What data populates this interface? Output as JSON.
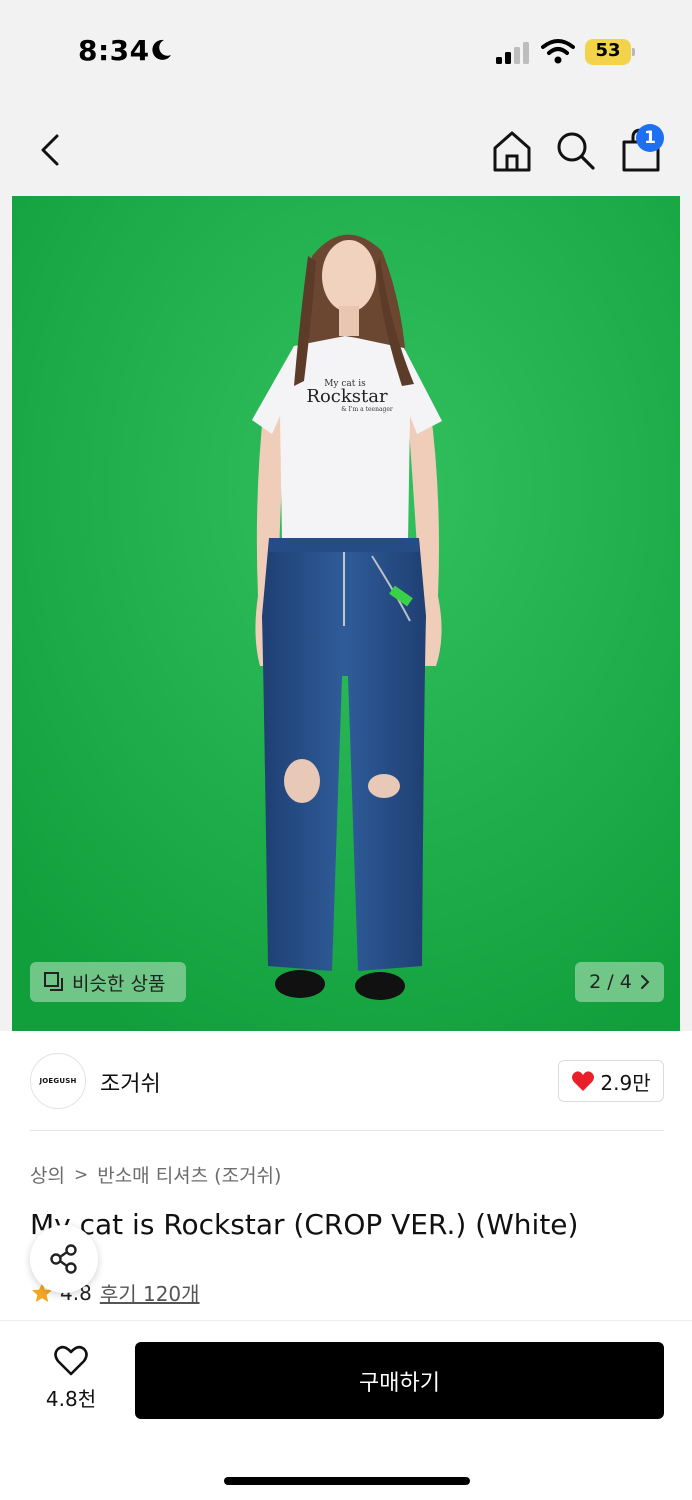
{
  "status_bar": {
    "time": "8:34",
    "battery": "53"
  },
  "nav": {
    "cart_badge": "1"
  },
  "image": {
    "similar_label": "비슷한 상품",
    "pager": "2 / 4",
    "shirt_text_line1": "My cat is",
    "shirt_text_line2": "Rockstar",
    "shirt_text_line3": "& I'm a teenager"
  },
  "brand": {
    "logo_text": "JOEGUSH",
    "name": "조거쉬",
    "likes": "2.9만"
  },
  "product": {
    "breadcrumb": [
      "상의",
      "반소매 티셔츠 (조거쉬)"
    ],
    "title": "My cat is Rockstar (CROP VER.) (White)",
    "rating": "4.8",
    "reviews": "후기 120개"
  },
  "bottom": {
    "wish_count": "4.8천",
    "buy_label": "구매하기"
  },
  "colors": {
    "background_green": "#1fb24a",
    "accent_blue": "#1e6ff2",
    "heart_red": "#e8202a",
    "star_orange": "#f5a623"
  }
}
